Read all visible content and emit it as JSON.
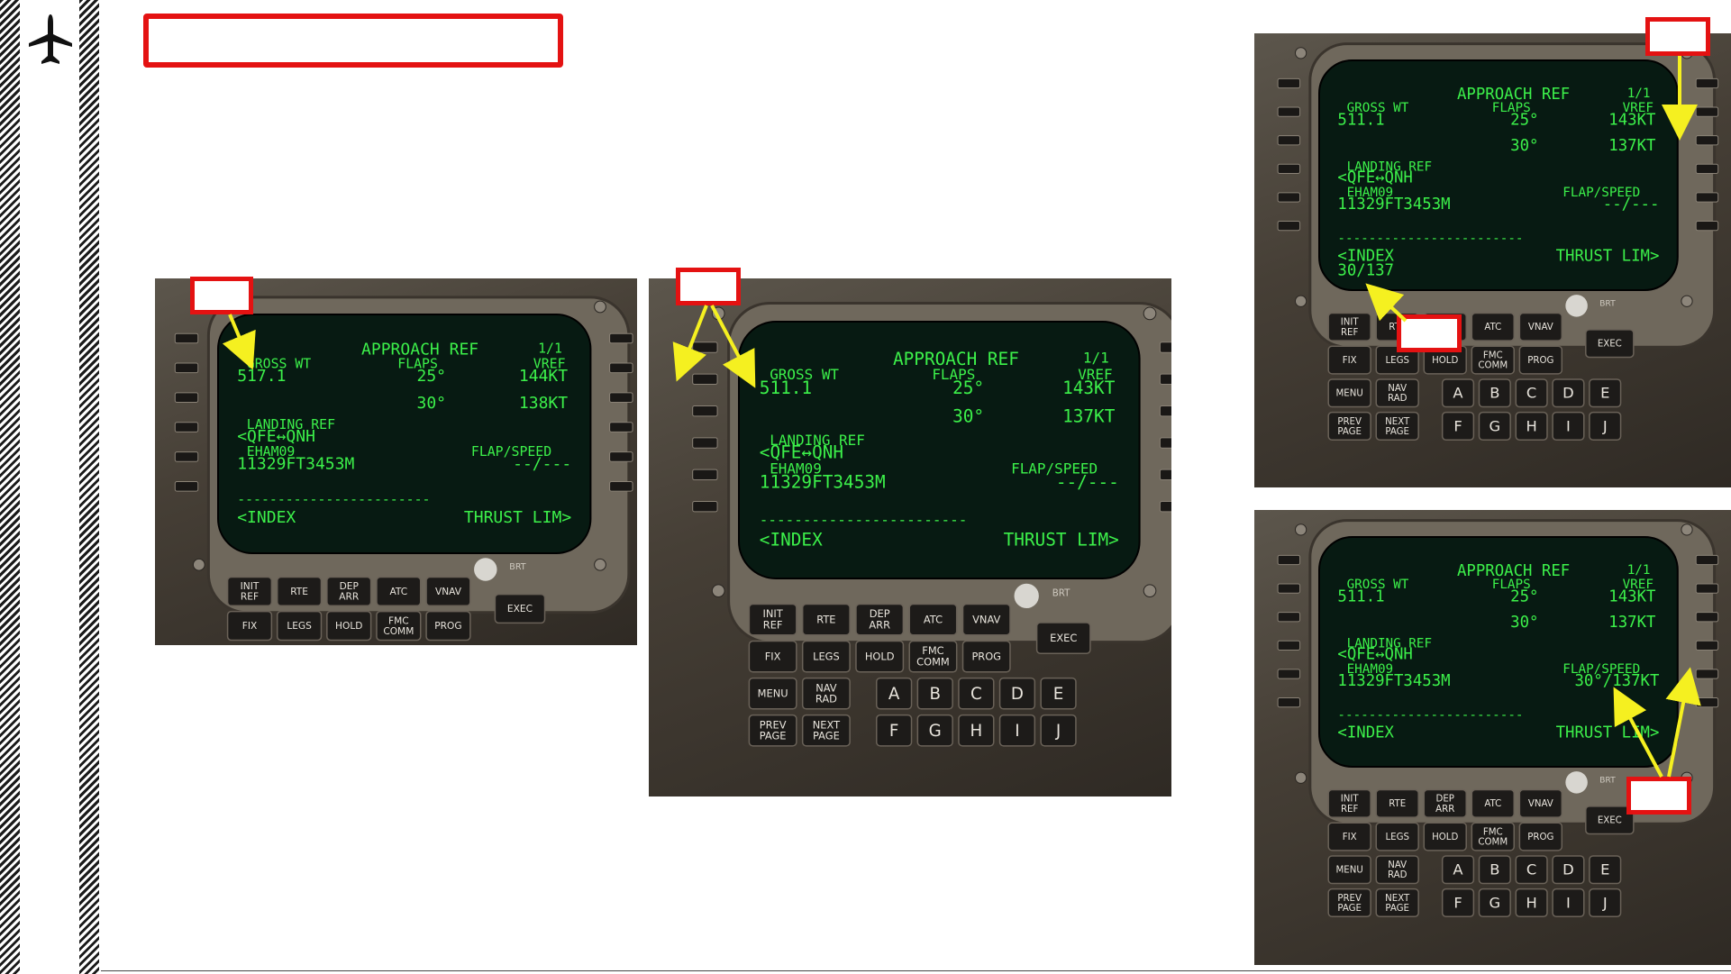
{
  "slide": {
    "title": "",
    "logo_icon": "airplane-icon"
  },
  "panel_1": {
    "page_title": "APPROACH REF",
    "page_num": "1/1",
    "gross_wt_label": "GROSS WT",
    "gross_wt": "517.1",
    "flaps_label": "FLAPS",
    "vref_label": "VREF",
    "flap1": "25°",
    "vref1": "144KT",
    "flap2": "30°",
    "vref2": "138KT",
    "landing_ref": "LANDING REF",
    "qfe_qnh": "<QFE↔QNH",
    "runway": "EHAM09",
    "rwy_length": "11329FT3453M",
    "flap_speed_label": "FLAP/SPEED",
    "flap_speed_value": "--/---",
    "dashes": "------------------------",
    "index": "<INDEX",
    "thrust_lim": "THRUST LIM>"
  },
  "panel_2": {
    "page_title": "APPROACH REF",
    "page_num": "1/1",
    "gross_wt_label": "GROSS WT",
    "gross_wt": "511.1",
    "flaps_label": "FLAPS",
    "vref_label": "VREF",
    "flap1": "25°",
    "vref1": "143KT",
    "flap2": "30°",
    "vref2": "137KT",
    "landing_ref": "LANDING REF",
    "qfe_qnh": "<QFE↔QNH",
    "runway": "EHAM09",
    "rwy_length": "11329FT3453M",
    "flap_speed_label": "FLAP/SPEED",
    "flap_speed_value": "--/---",
    "dashes": "------------------------",
    "index": "<INDEX",
    "thrust_lim": "THRUST LIM>"
  },
  "panel_3": {
    "page_title": "APPROACH REF",
    "page_num": "1/1",
    "gross_wt_label": "GROSS WT",
    "gross_wt": "511.1",
    "flaps_label": "FLAPS",
    "vref_label": "VREF",
    "flap1": "25°",
    "vref1": "143KT",
    "flap2": "30°",
    "vref2": "137KT",
    "landing_ref": "LANDING REF",
    "qfe_qnh": "<QFE↔QNH",
    "runway": "EHAM09",
    "rwy_length": "11329FT3453M",
    "flap_speed_label": "FLAP/SPEED",
    "flap_speed_value": "--/---",
    "dashes": "------------------------",
    "index": "<INDEX",
    "scratchpad": "30/137",
    "thrust_lim": "THRUST LIM>"
  },
  "panel_4": {
    "page_title": "APPROACH REF",
    "page_num": "1/1",
    "gross_wt_label": "GROSS WT",
    "gross_wt": "511.1",
    "flaps_label": "FLAPS",
    "vref_label": "VREF",
    "flap1": "25°",
    "vref1": "143KT",
    "flap2": "30°",
    "vref2": "137KT",
    "landing_ref": "LANDING REF",
    "qfe_qnh": "<QFE↔QNH",
    "runway": "EHAM09",
    "rwy_length": "11329FT3453M",
    "flap_speed_label": "FLAP/SPEED",
    "flap_speed_value": "30°/137KT",
    "dashes": "------------------------",
    "index": "<INDEX",
    "thrust_lim": "THRUST LIM>"
  },
  "keys": {
    "row1": [
      "INIT\nREF",
      "RTE",
      "DEP\nARR",
      "ATC",
      "VNAV"
    ],
    "row2": [
      "FIX",
      "LEGS",
      "HOLD",
      "FMC\nCOMM",
      "PROG"
    ],
    "row3": [
      "MENU",
      "NAV\nRAD"
    ],
    "row4": [
      "PREV\nPAGE",
      "NEXT\nPAGE"
    ],
    "letters1": [
      "A",
      "B",
      "C",
      "D",
      "E"
    ],
    "letters2": [
      "F",
      "G",
      "H",
      "I",
      "J"
    ],
    "exec": "EXEC",
    "brt": "BRT"
  },
  "colors": {
    "accent_red": "#e41212",
    "arrow_yellow": "#f5f020",
    "screen_green": "#3cf04a"
  }
}
